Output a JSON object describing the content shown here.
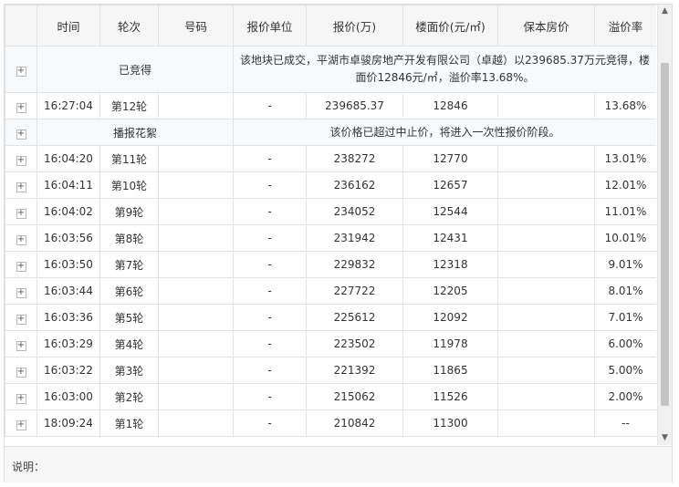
{
  "columns": [
    "",
    "时间",
    "轮次",
    "号码",
    "报价单位",
    "报价(万)",
    "楼面价(元/㎡)",
    "保本房价",
    "溢价率"
  ],
  "expand_symbol": "+",
  "rows": [
    {
      "kind": "notice",
      "label": "已竞得",
      "message": "该地块已成交，平湖市卓骏房地产开发有限公司（卓越）以239685.37万元竞得，楼面价12846元/㎡，溢价率13.68%。"
    },
    {
      "kind": "bid",
      "time": "16:27:04",
      "round": "第12轮",
      "number": "",
      "unit": "-",
      "price": "239685.37",
      "floor_price": "12846",
      "breakeven": "",
      "premium": "13.68%"
    },
    {
      "kind": "notice",
      "label": "播报花絮",
      "message": "该价格已超过中止价，将进入一次性报价阶段。"
    },
    {
      "kind": "bid",
      "time": "16:04:20",
      "round": "第11轮",
      "number": "",
      "unit": "-",
      "price": "238272",
      "floor_price": "12770",
      "breakeven": "",
      "premium": "13.01%"
    },
    {
      "kind": "bid",
      "time": "16:04:11",
      "round": "第10轮",
      "number": "",
      "unit": "-",
      "price": "236162",
      "floor_price": "12657",
      "breakeven": "",
      "premium": "12.01%"
    },
    {
      "kind": "bid",
      "time": "16:04:02",
      "round": "第9轮",
      "number": "",
      "unit": "-",
      "price": "234052",
      "floor_price": "12544",
      "breakeven": "",
      "premium": "11.01%"
    },
    {
      "kind": "bid",
      "time": "16:03:56",
      "round": "第8轮",
      "number": "",
      "unit": "-",
      "price": "231942",
      "floor_price": "12431",
      "breakeven": "",
      "premium": "10.01%"
    },
    {
      "kind": "bid",
      "time": "16:03:50",
      "round": "第7轮",
      "number": "",
      "unit": "-",
      "price": "229832",
      "floor_price": "12318",
      "breakeven": "",
      "premium": "9.01%"
    },
    {
      "kind": "bid",
      "time": "16:03:44",
      "round": "第6轮",
      "number": "",
      "unit": "-",
      "price": "227722",
      "floor_price": "12205",
      "breakeven": "",
      "premium": "8.01%"
    },
    {
      "kind": "bid",
      "time": "16:03:36",
      "round": "第5轮",
      "number": "",
      "unit": "-",
      "price": "225612",
      "floor_price": "12092",
      "breakeven": "",
      "premium": "7.01%"
    },
    {
      "kind": "bid",
      "time": "16:03:29",
      "round": "第4轮",
      "number": "",
      "unit": "-",
      "price": "223502",
      "floor_price": "11978",
      "breakeven": "",
      "premium": "6.00%"
    },
    {
      "kind": "bid",
      "time": "16:03:22",
      "round": "第3轮",
      "number": "",
      "unit": "-",
      "price": "221392",
      "floor_price": "11865",
      "breakeven": "",
      "premium": "5.00%"
    },
    {
      "kind": "bid",
      "time": "16:03:00",
      "round": "第2轮",
      "number": "",
      "unit": "-",
      "price": "215062",
      "floor_price": "11526",
      "breakeven": "",
      "premium": "2.00%"
    },
    {
      "kind": "bid",
      "time": "18:09:24",
      "round": "第1轮",
      "number": "",
      "unit": "-",
      "price": "210842",
      "floor_price": "11300",
      "breakeven": "",
      "premium": "--"
    }
  ],
  "footer": {
    "note_label": "说明："
  },
  "scrollbar": {
    "up": "▲",
    "down": "▼"
  }
}
